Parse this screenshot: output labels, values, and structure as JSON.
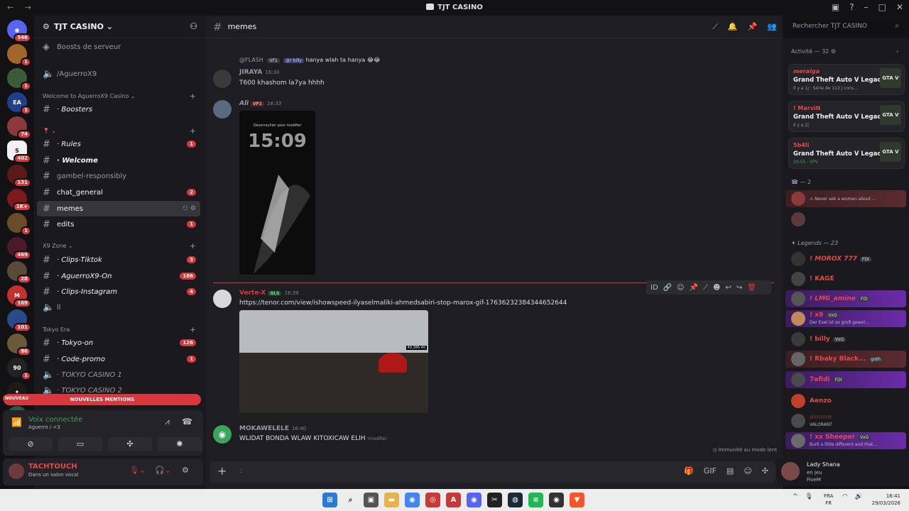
{
  "window": {
    "title": "TJT CASINO",
    "nav": "← →"
  },
  "server": {
    "name": "TJT CASINO",
    "boosts": "Boosts de serveur"
  },
  "guild_badges": [
    "546",
    "1",
    "1",
    "1",
    "74",
    "402",
    "131",
    "1K+",
    "1",
    "469",
    "28",
    "169",
    "101",
    "86",
    "1",
    "1"
  ],
  "sidebar": {
    "voice_channel": "/AguerroX9",
    "cat_welcome": "Welcome to AguerroX9 Casino",
    "cat_x9": "X9 Zone",
    "cat_tokyo": "Tokyo Era",
    "channels": [
      {
        "name": "· Boosters",
        "count": ""
      },
      {
        "name": "· Rules",
        "count": "1"
      },
      {
        "name": "· Welcome",
        "count": ""
      },
      {
        "name": "gambel-responsibly",
        "count": ""
      },
      {
        "name": "chat_general",
        "count": "2"
      },
      {
        "name": "memes",
        "count": ""
      },
      {
        "name": "edits",
        "count": "1"
      },
      {
        "name": "· Clips-Tiktok",
        "count": "3"
      },
      {
        "name": "· AguerroX9-On",
        "count": "186"
      },
      {
        "name": "· Clips-Instagram",
        "count": "4"
      },
      {
        "name": "ll",
        "count": ""
      },
      {
        "name": "· Tokyo-on",
        "count": "126"
      },
      {
        "name": "· Code-promo",
        "count": "1"
      },
      {
        "name": "· TOKYO CASINO 1",
        "count": ""
      },
      {
        "name": "· TOKYO CASINO 2",
        "count": ""
      }
    ],
    "new_mentions": "NOUVELLES MENTIONS",
    "nouveau": "NOUVEAU"
  },
  "voice": {
    "title": "Voix connectée",
    "sub": "Aguerro / <3"
  },
  "user": {
    "name": "TACHTOUCH",
    "status": "Dans un salon vocal"
  },
  "channel": {
    "name": "memes"
  },
  "search": {
    "placeholder": "Rechercher TJT CASINO"
  },
  "messages": [
    {
      "reply": "@FLASH",
      "reply_tag": "VF1",
      "reply_mention": "@! billy",
      "reply_text": "hanya wlah ta hanya 😂😂",
      "author": "JIRAYA",
      "time": "16:30",
      "text": "T600 khashom la7ya hhhh",
      "color": "#949ba4"
    },
    {
      "author": "Ali",
      "tag": "VF1",
      "time": "16:33",
      "phone_time": "15:09",
      "phone_text": "Déverrouiller pour modifier",
      "color": "#949ba4"
    },
    {
      "author": "Verte-X",
      "tag": "GLS",
      "time": "16:39",
      "link": "https://tenor.com/view/ishowspeed-ilyaselmaliki-ahmedsabiri-stop-marox-gif-17636232384344652644",
      "gif_counter": "49,386.40",
      "color": "#da373c"
    },
    {
      "author": "MOKAWELELE",
      "time": "16:40",
      "text": "WLIDAT BONDA WLAW KITOXICAW ELIH",
      "edited": "(modifié)",
      "color": "#949ba4"
    }
  ],
  "slowmode": "Immunité au mode lent",
  "composer": {
    "placeholder": ":"
  },
  "members": {
    "activity_header": "Activité — 32",
    "activities": [
      {
        "user": "meraiga",
        "game": "Grand Theft Auto V Legacy",
        "detail": "Il y a 1j · Série de 113 j cons..."
      },
      {
        "user": "! MarviN",
        "game": "Grand Theft Auto V Legacy",
        "detail": "Il y a 2j"
      },
      {
        "user": "5b4li",
        "game": "Grand Theft Auto V Legacy",
        "detail": "20:55 · VPV"
      }
    ],
    "group2": "— 2",
    "g2_status": "Never ask a woman about ...",
    "legends_header": "Legends — 23",
    "legends": [
      {
        "name": "! MOROX 777",
        "tag": "FDI",
        "status": ""
      },
      {
        "name": "! KAGE",
        "tag": "",
        "status": ""
      },
      {
        "name": "! LMG_amine",
        "tag": "FDI",
        "status": ""
      },
      {
        "name": "! x9",
        "tag": "VxG",
        "status": "Der Esel ist so groß gewor..."
      },
      {
        "name": "! billy",
        "tag": "VxG",
        "status": ""
      },
      {
        "name": "! Rbaky Black...",
        "tag": "goth",
        "status": ""
      },
      {
        "name": "7afidi",
        "tag": "FDI",
        "status": ""
      },
      {
        "name": "Aenzo",
        "tag": "",
        "status": ""
      },
      {
        "name": "anone",
        "tag": "",
        "status": "VALORANT"
      },
      {
        "name": "! xx Sheeper",
        "tag": "VxG",
        "status": "Built a little different and that..."
      }
    ],
    "gta_label": "GTA V"
  },
  "live": {
    "name": "Lady Shana",
    "status": "en jeu",
    "game": "FiveM"
  },
  "taskbar": {
    "lang1": "FRA",
    "lang2": "FR",
    "time": "16:41",
    "date": "29/03/2026"
  }
}
